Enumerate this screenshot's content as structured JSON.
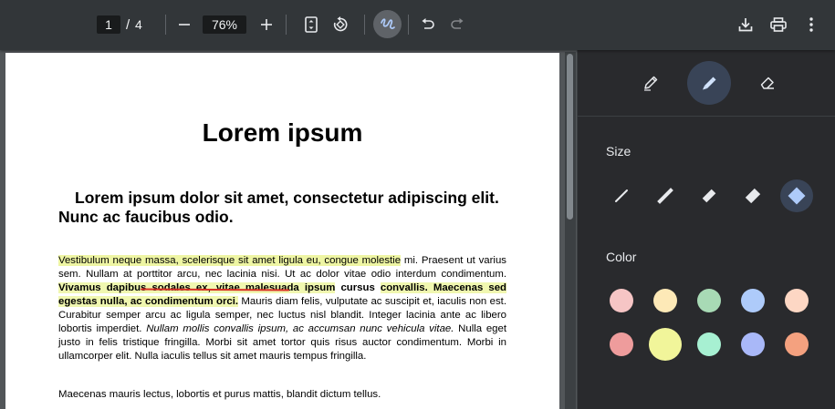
{
  "toolbar": {
    "page_current": "1",
    "page_separator": "/",
    "page_total": "4",
    "zoom_value": "76%",
    "icons": [
      "minus-icon",
      "plus-icon",
      "fit-page-icon",
      "rotate-icon",
      "annotate-icon",
      "undo-icon",
      "redo-icon",
      "download-icon",
      "print-icon",
      "more-icon"
    ]
  },
  "document": {
    "title": "Lorem ipsum",
    "subtitle": "Lorem ipsum dolor sit amet, consectetur adipiscing elit. Nunc ac faucibus odio.",
    "para1": {
      "hl_a": "Vestibulum neque massa, scelerisque sit amet ligula eu, congue molestie",
      "t1": " mi. Praesent ut varius sem. Nullam at porttitor arcu, nec lacinia nisi. Ut ac dolor vitae odio interdum condimentum. ",
      "b1": "Vivamus dapibus sodales ex, vitae malesuada ipsum",
      "b2": " cursus ",
      "b3": "convallis. Maecenas sed egestas nulla, ac condimentum orci.",
      "t2": " Mauris diam felis, vulputate ac suscipit et, iaculis non est. Curabitur semper arcu ac ligula semper, nec luctus nisl blandit. Integer lacinia ante ac libero lobortis imperdiet. ",
      "i1": "Nullam mollis convallis ipsum, ac accumsan nunc vehicula vitae.",
      "t3": " Nulla eget justo in felis tristique fringilla. Morbi sit amet tortor quis risus auctor condimentum. Morbi in ullamcorper elit. Nulla iaculis tellus sit amet mauris tempus fringilla."
    },
    "para2": "Maecenas mauris lectus, lobortis et purus mattis, blandit dictum tellus."
  },
  "panel": {
    "tools": [
      {
        "name": "pen-icon",
        "active": false
      },
      {
        "name": "highlighter-icon",
        "active": true
      },
      {
        "name": "eraser-icon",
        "active": false
      }
    ],
    "size_label": "Size",
    "sizes": [
      1,
      2,
      3,
      4,
      5
    ],
    "size_selected_index": 4,
    "color_label": "Color",
    "colors": [
      [
        "#f6c5c5",
        "#fde9b7",
        "#a8dab5",
        "#aecbfa",
        "#fdd7c4"
      ],
      [
        "#ee9c9c",
        "#f1f59a",
        "#a7f0d2",
        "#a9b8f8",
        "#f4a17f"
      ]
    ],
    "color_selected": "#f1f59a",
    "accent": "#8ab4f8"
  }
}
